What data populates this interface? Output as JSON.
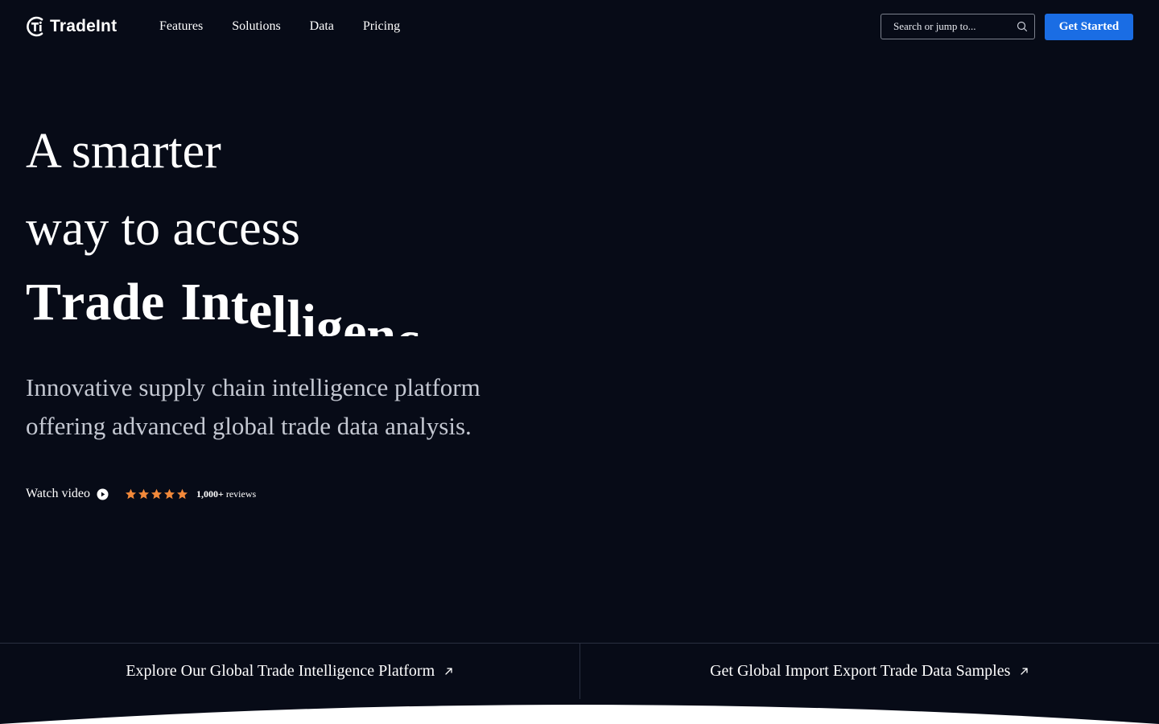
{
  "brand": {
    "name": "TradeInt"
  },
  "nav": {
    "items": [
      {
        "label": "Features"
      },
      {
        "label": "Solutions"
      },
      {
        "label": "Data"
      },
      {
        "label": "Pricing"
      }
    ]
  },
  "search": {
    "placeholder": "Search or jump to...",
    "icon": "search-icon"
  },
  "header": {
    "cta_label": "Get Started",
    "cta_color": "#1a6de4"
  },
  "hero": {
    "headline_line1": "A smarter",
    "headline_line2": "way to access",
    "headline_line3": "Trade Intelligence",
    "subtitle_line1": "Innovative supply chain intelligence platform",
    "subtitle_line2": "offering advanced global trade data analysis.",
    "watch_video_label": "Watch video",
    "rating": {
      "stars": 5,
      "count": "1,000+",
      "label": "reviews",
      "star_color": "#f2893a"
    }
  },
  "bottom_links": [
    {
      "label": "Explore Our Global Trade Intelligence Platform"
    },
    {
      "label": "Get Global Import Export Trade Data Samples"
    }
  ],
  "colors": {
    "background": "#070b17",
    "text": "#ffffff",
    "subtitle": "#c4c8d2"
  }
}
